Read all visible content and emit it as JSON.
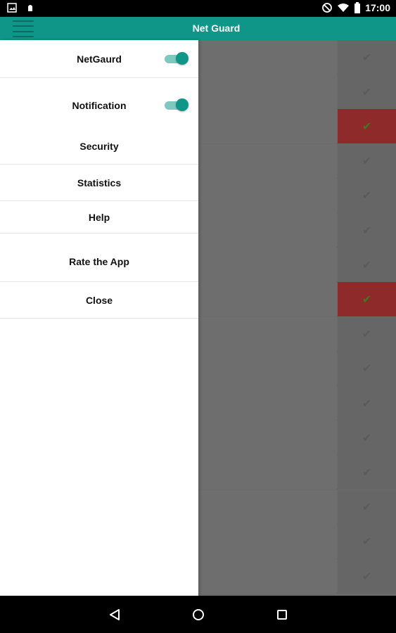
{
  "status_bar": {
    "time": "17:00",
    "icons": [
      "image-icon",
      "notification-icon",
      "do-not-disturb-icon",
      "wifi-icon",
      "battery-icon"
    ]
  },
  "app_bar": {
    "title": "Net Guard"
  },
  "drawer": {
    "items": [
      {
        "label": "NetGaurd",
        "toggle": true,
        "toggle_on": true
      },
      {
        "label": "Notification",
        "toggle": true,
        "toggle_on": true
      },
      {
        "label": "Security"
      },
      {
        "label": "Statistics"
      },
      {
        "label": "Help"
      },
      {
        "label": "Rate the App"
      },
      {
        "label": "Close"
      }
    ]
  },
  "background_list": {
    "check_glyph": "✔",
    "alert_rows": [
      2,
      7
    ],
    "colors": {
      "alert": "#8e2a2a",
      "check_on_alert": "#3d7a1e"
    }
  },
  "nav_bar": {
    "buttons": [
      "back-icon",
      "home-icon",
      "recents-icon"
    ]
  },
  "colors": {
    "accent": "#0f9688"
  }
}
